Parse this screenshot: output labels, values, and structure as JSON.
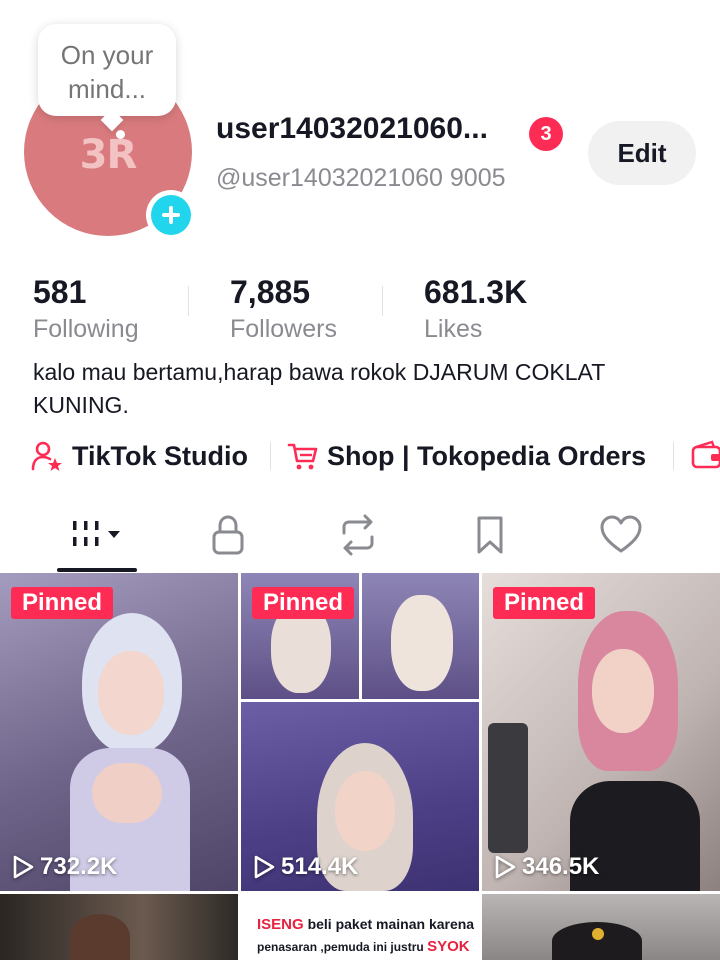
{
  "profile": {
    "bubble_text": "On your mind...",
    "avatar_text": "3R",
    "username": "user14032021060...",
    "notification_count": "3",
    "handle": "@user14032021060 9005",
    "edit_label": "Edit",
    "bio": "kalo mau bertamu,harap bawa rokok DJARUM COKLAT KUNING."
  },
  "stats": [
    {
      "value": "581",
      "label": "Following"
    },
    {
      "value": "7,885",
      "label": "Followers"
    },
    {
      "value": "681.3K",
      "label": "Likes"
    }
  ],
  "links": [
    {
      "label": "TikTok Studio",
      "icon": "person-star-icon"
    },
    {
      "label": "Shop | Tokopedia Orders",
      "icon": "cart-icon"
    },
    {
      "label": "",
      "icon": "wallet-icon"
    }
  ],
  "tabs": [
    {
      "name": "videos",
      "icon": "grid-icon",
      "active": true
    },
    {
      "name": "private",
      "icon": "lock-icon",
      "active": false
    },
    {
      "name": "reposts",
      "icon": "repost-icon",
      "active": false
    },
    {
      "name": "favorites",
      "icon": "bookmark-icon",
      "active": false
    },
    {
      "name": "liked",
      "icon": "heart-icon",
      "active": false
    }
  ],
  "videos": [
    {
      "pinned_label": "Pinned",
      "views": "732.2K"
    },
    {
      "pinned_label": "Pinned",
      "views": "514.4K"
    },
    {
      "pinned_label": "Pinned",
      "views": "346.5K"
    },
    {
      "pinned_label": "",
      "views": ""
    },
    {
      "pinned_label": "",
      "views": "",
      "caption": {
        "word1": "ISENG",
        "text1": "beli paket mainan karena",
        "text2": "penasaran ,pemuda ini justru",
        "word2": "SYOK"
      }
    },
    {
      "pinned_label": "",
      "views": ""
    }
  ],
  "colors": {
    "accent": "#fe2c55",
    "avatar_bg": "#d97b7e",
    "plus_badge": "#20d5ec",
    "muted_text": "#8a8b91"
  }
}
